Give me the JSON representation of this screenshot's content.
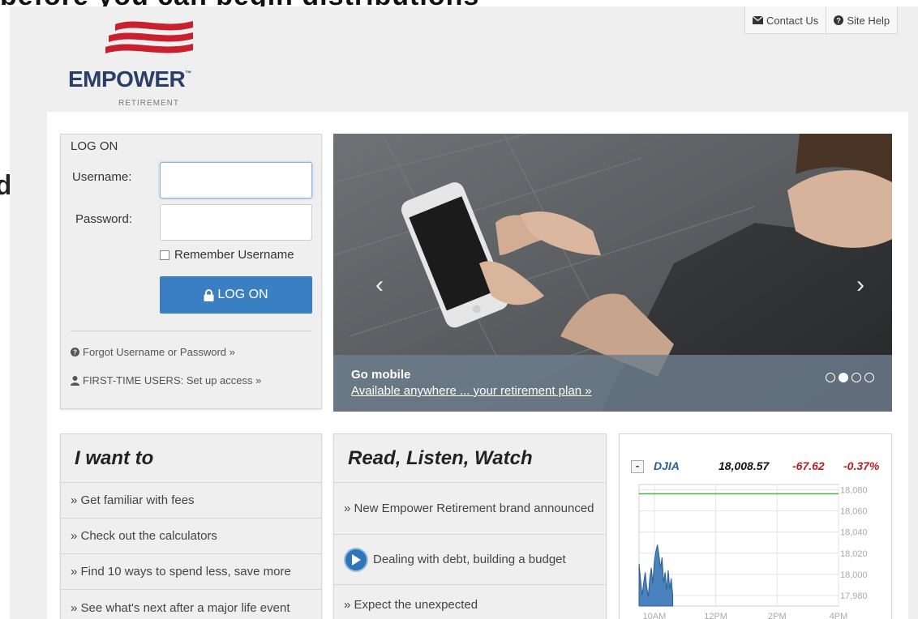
{
  "background": {
    "heading": "before you can begin distributions",
    "side_letter": "d"
  },
  "brand": {
    "name": "EMPOWER",
    "trademark": "™",
    "tagline": "RETIREMENT",
    "colors": {
      "navy": "#2b3f66",
      "red": "#c8202f",
      "button_blue": "#3a7fc2"
    }
  },
  "top_links": [
    {
      "label": "Contact Us",
      "icon": "envelope-icon"
    },
    {
      "label": "Site Help",
      "icon": "question-circle-icon"
    }
  ],
  "login": {
    "title": "LOG ON",
    "username_label": "Username:",
    "username_value": "",
    "password_label": "Password:",
    "password_value": "",
    "remember_label": "Remember Username",
    "remember_checked": false,
    "button_label": "LOG ON",
    "forgot_link": "Forgot Username or Password »",
    "first_time_link": "FIRST-TIME USERS: Set up access »"
  },
  "hero": {
    "title": "Go mobile",
    "link": "Available anywhere ... your retirement plan »",
    "slide_count": 4,
    "active_slide": 2
  },
  "i_want_to": {
    "title": "I want to",
    "items": [
      "» Get familiar with fees",
      "» Check out the calculators",
      "» Find 10 ways to spend less, save more",
      "» See what's next after a major life event"
    ]
  },
  "read_listen_watch": {
    "title": "Read, Listen, Watch",
    "items": [
      "» New Empower Retirement brand announced",
      "Dealing with debt, building a budget",
      "» Expect the unexpected"
    ]
  },
  "djia": {
    "collapse": "-",
    "symbol": "DJIA",
    "value": "18,008.57",
    "change": "-67.62",
    "percent": "-0.37%",
    "chart_data": {
      "type": "area",
      "y_ticks": [
        "18,080",
        "18,060",
        "18,040",
        "18,020",
        "18,000",
        "17,980"
      ],
      "x_ticks": [
        "10AM",
        "12PM",
        "2PM",
        "4PM"
      ],
      "ylim": [
        17970,
        18085
      ],
      "previous_close": 18076.19,
      "times": [
        9.5,
        9.55,
        9.6,
        9.65,
        9.7,
        9.75,
        9.8,
        9.85,
        9.9,
        9.95,
        10.0,
        10.05,
        10.1,
        10.15,
        10.2,
        10.25,
        10.3,
        10.35,
        10.4,
        10.45,
        10.5,
        10.55,
        10.6
      ],
      "values": [
        18010,
        17995,
        17980,
        17992,
        18002,
        17988,
        17979,
        17996,
        18006,
        17992,
        18012,
        18022,
        18028,
        18018,
        18006,
        18016,
        17992,
        18002,
        17985,
        18004,
        17986,
        17996,
        17980
      ],
      "colors": {
        "fill": "#4a82bd",
        "line": "#2c5f93",
        "prev_close": "#4caf50"
      }
    }
  }
}
